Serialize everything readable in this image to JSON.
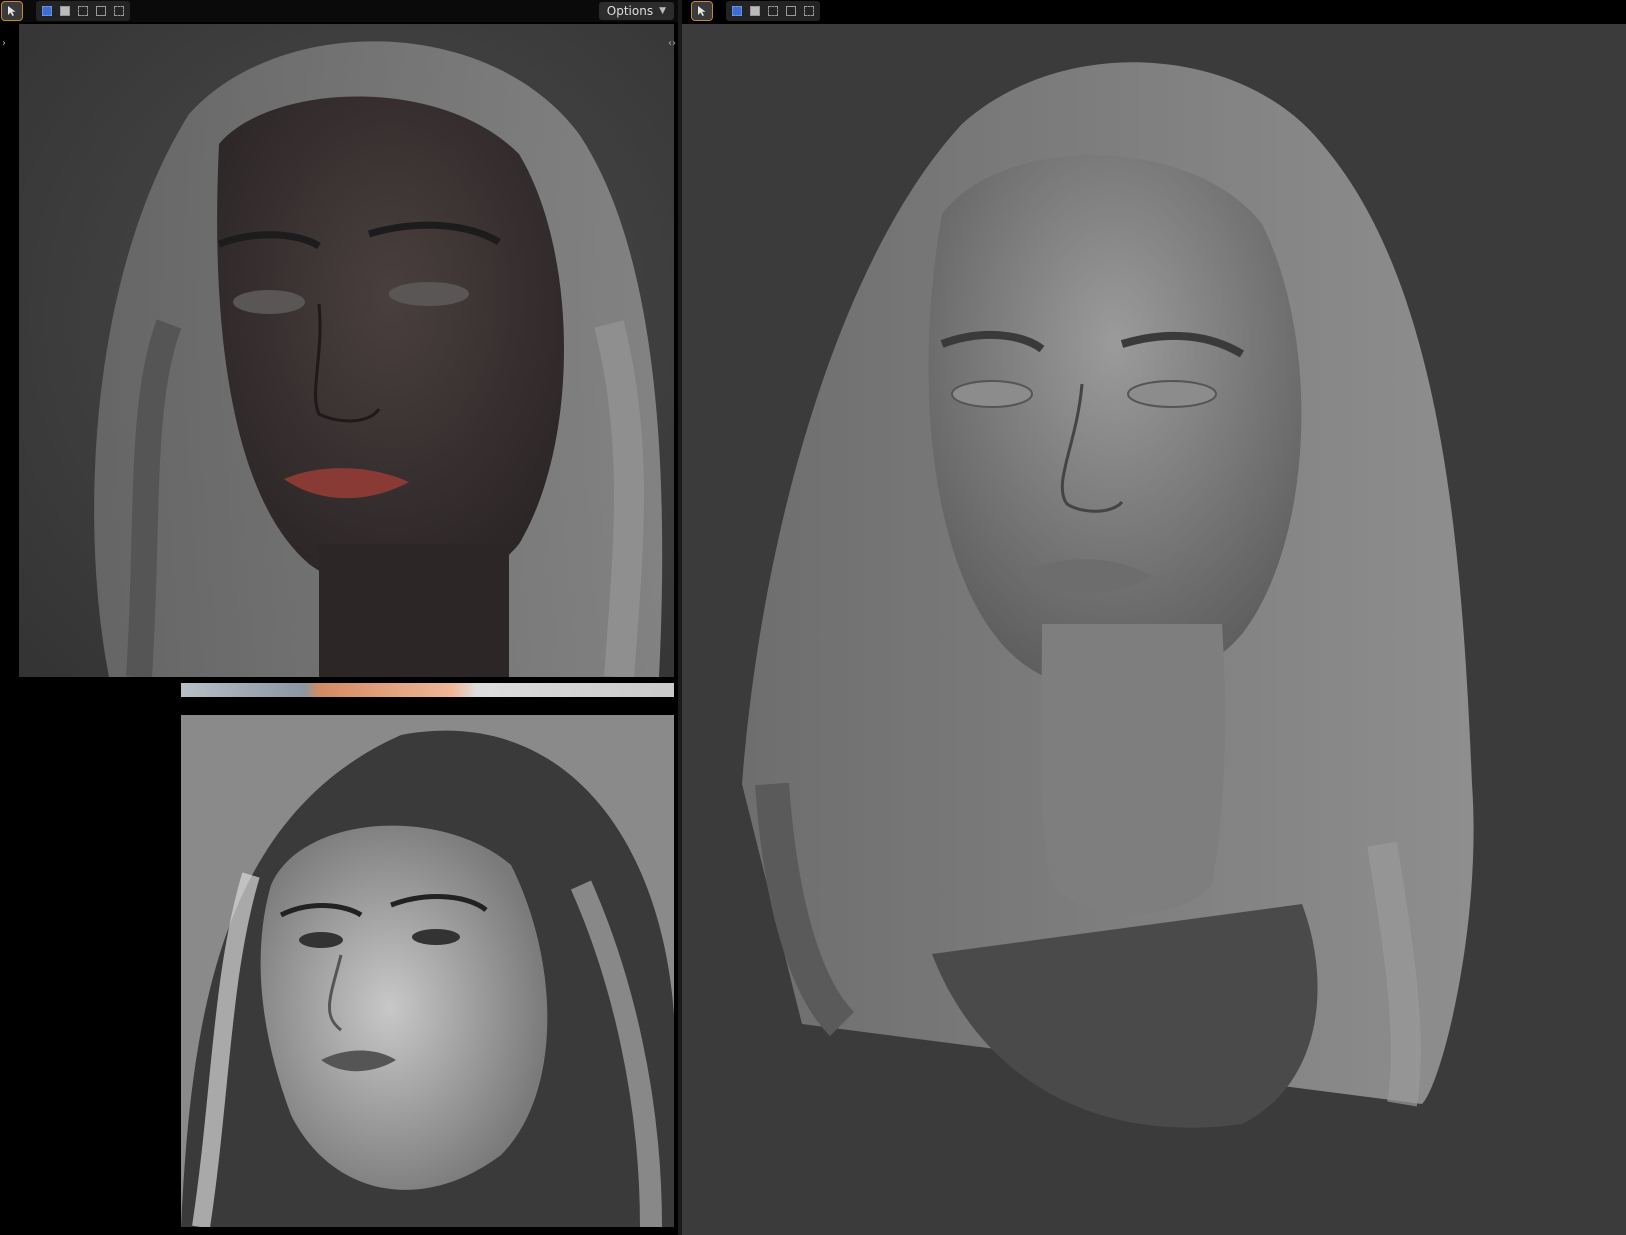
{
  "left_header": {
    "options_label": "Options",
    "tools": [
      "select-tool",
      "mode-new",
      "mode-extend",
      "mode-subtract",
      "mode-invert",
      "mode-intersect"
    ]
  },
  "right_header": {
    "tools": [
      "select-tool",
      "mode-new",
      "mode-extend",
      "mode-subtract",
      "mode-invert",
      "mode-intersect"
    ]
  },
  "colors": {
    "viewport_bg": "#3b3b3b",
    "header_bg": "#0a0a0a",
    "selected_mode": "#3d6fd1",
    "active_tool_outline": "#c78a2a",
    "lip_red": "#8a3a34"
  }
}
